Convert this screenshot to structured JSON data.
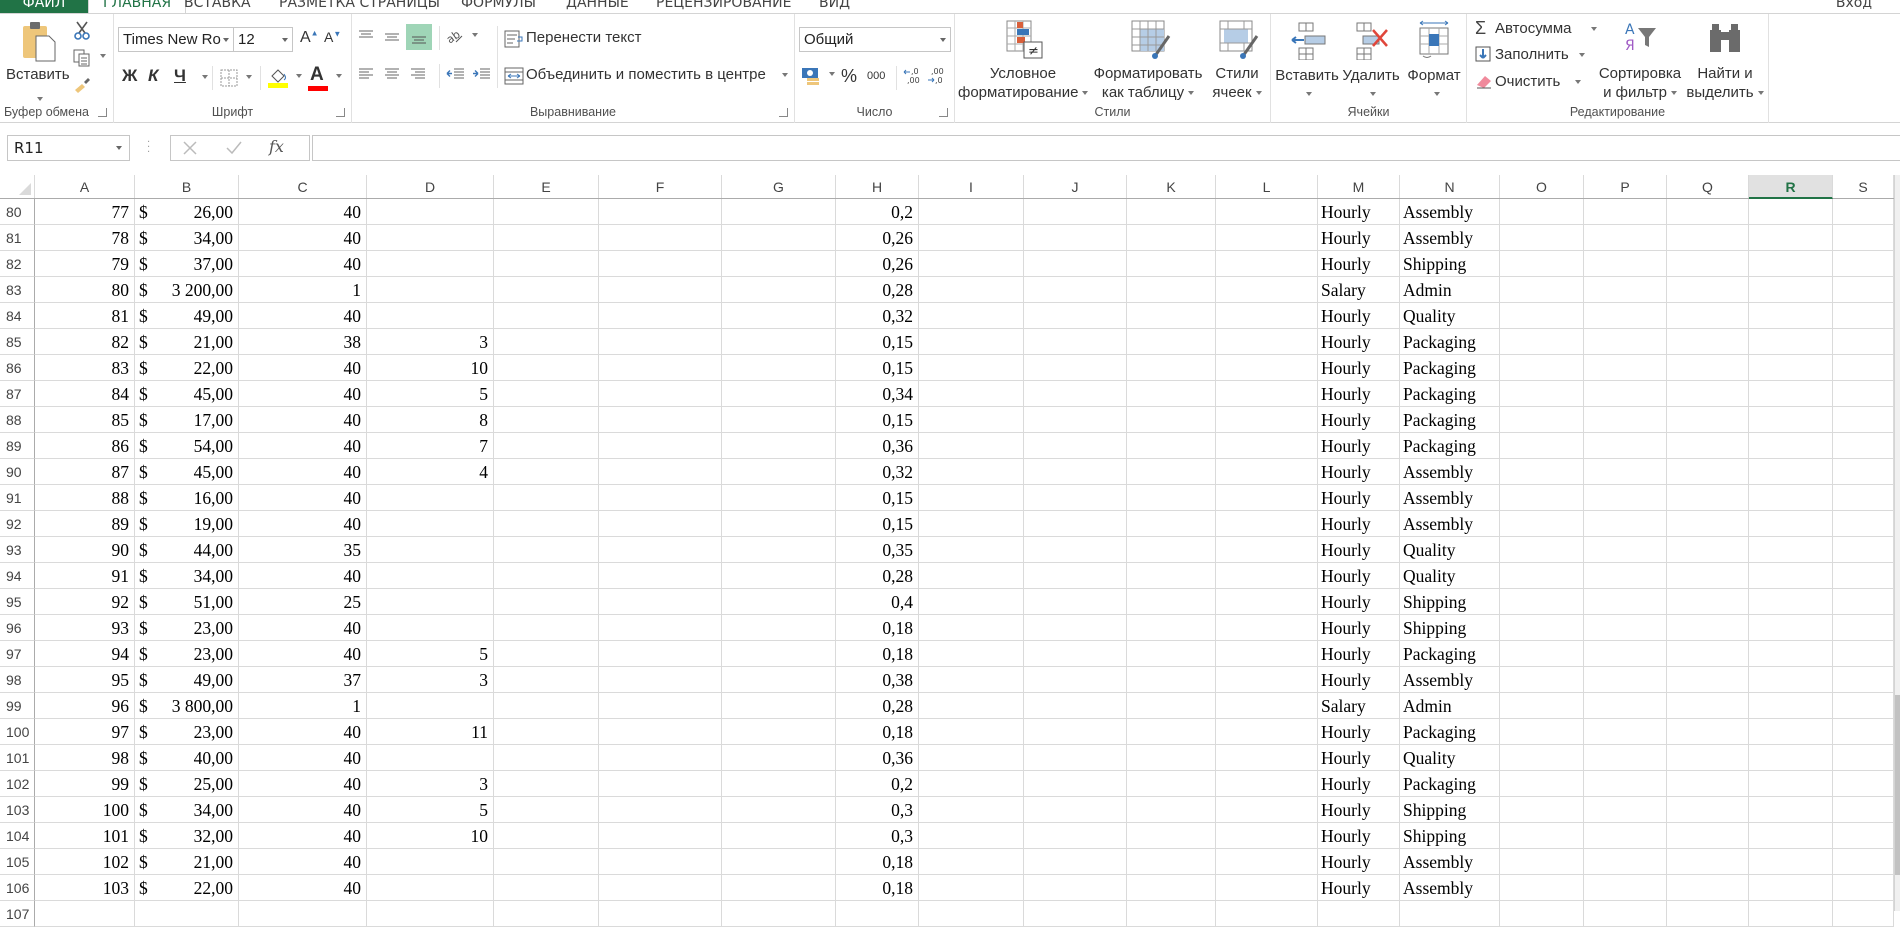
{
  "tabs": [
    {
      "label": "ФАЙЛ",
      "active": false
    },
    {
      "label": "ГЛАВНАЯ",
      "active": true
    },
    {
      "label": "ВСТАВКА",
      "active": false
    },
    {
      "label": "РАЗМЕТКА СТРАНИЦЫ",
      "active": false
    },
    {
      "label": "ФОРМУЛЫ",
      "active": false
    },
    {
      "label": "ДАННЫЕ",
      "active": false
    },
    {
      "label": "РЕЦЕНЗИРОВАНИЕ",
      "active": false
    },
    {
      "label": "ВИД",
      "active": false
    }
  ],
  "signin_label": "Вход",
  "ribbon": {
    "clipboard": {
      "group_label": "Буфер обмена",
      "paste_label": "Вставить"
    },
    "font": {
      "group_label": "Шрифт",
      "font_name": "Times New Ro",
      "font_size": "12",
      "bold": "Ж",
      "italic": "К",
      "underline": "Ч",
      "font_color_glyph": "A",
      "fill_color": "#ffff00",
      "font_color": "#ff0000"
    },
    "alignment": {
      "group_label": "Выравнивание",
      "wrap_text": "Перенести текст",
      "merge_center": "Объединить и поместить в центре"
    },
    "number": {
      "group_label": "Число",
      "format": "Общий",
      "percent": "%",
      "thousands": "000",
      "inc_decimal": "←,0 ,00",
      "dec_decimal": ",00 →,0"
    },
    "styles": {
      "group_label": "Стили",
      "conditional_line1": "Условное",
      "conditional_line2": "форматирование",
      "format_table_line1": "Форматировать",
      "format_table_line2": "как таблицу",
      "cell_styles_line1": "Стили",
      "cell_styles_line2": "ячеек"
    },
    "cells": {
      "group_label": "Ячейки",
      "insert": "Вставить",
      "delete": "Удалить",
      "format": "Формат"
    },
    "editing": {
      "group_label": "Редактирование",
      "autosum": "Автосумма",
      "fill": "Заполнить",
      "clear": "Очистить",
      "sort_line1": "Сортировка",
      "sort_line2": "и фильтр",
      "find_line1": "Найти и",
      "find_line2": "выделить"
    }
  },
  "formula_bar": {
    "name_box": "R11",
    "formula": ""
  },
  "grid": {
    "columns": [
      "A",
      "B",
      "C",
      "D",
      "E",
      "F",
      "G",
      "H",
      "I",
      "J",
      "K",
      "L",
      "M",
      "N",
      "O",
      "P",
      "Q",
      "R",
      "S"
    ],
    "selected_column": "R",
    "rows": [
      {
        "n": "80",
        "A": "77",
        "B_cur": "$",
        "B_amt": "26,00",
        "C": "40",
        "D": "",
        "H": "0,2",
        "M": "Hourly",
        "N": "Assembly"
      },
      {
        "n": "81",
        "A": "78",
        "B_cur": "$",
        "B_amt": "34,00",
        "C": "40",
        "D": "",
        "H": "0,26",
        "M": "Hourly",
        "N": "Assembly"
      },
      {
        "n": "82",
        "A": "79",
        "B_cur": "$",
        "B_amt": "37,00",
        "C": "40",
        "D": "",
        "H": "0,26",
        "M": "Hourly",
        "N": "Shipping"
      },
      {
        "n": "83",
        "A": "80",
        "B_cur": "$",
        "B_amt": "3 200,00",
        "C": "1",
        "D": "",
        "H": "0,28",
        "M": "Salary",
        "N": "Admin"
      },
      {
        "n": "84",
        "A": "81",
        "B_cur": "$",
        "B_amt": "49,00",
        "C": "40",
        "D": "",
        "H": "0,32",
        "M": "Hourly",
        "N": "Quality"
      },
      {
        "n": "85",
        "A": "82",
        "B_cur": "$",
        "B_amt": "21,00",
        "C": "38",
        "D": "3",
        "H": "0,15",
        "M": "Hourly",
        "N": "Packaging"
      },
      {
        "n": "86",
        "A": "83",
        "B_cur": "$",
        "B_amt": "22,00",
        "C": "40",
        "D": "10",
        "H": "0,15",
        "M": "Hourly",
        "N": "Packaging"
      },
      {
        "n": "87",
        "A": "84",
        "B_cur": "$",
        "B_amt": "45,00",
        "C": "40",
        "D": "5",
        "H": "0,34",
        "M": "Hourly",
        "N": "Packaging"
      },
      {
        "n": "88",
        "A": "85",
        "B_cur": "$",
        "B_amt": "17,00",
        "C": "40",
        "D": "8",
        "H": "0,15",
        "M": "Hourly",
        "N": "Packaging"
      },
      {
        "n": "89",
        "A": "86",
        "B_cur": "$",
        "B_amt": "54,00",
        "C": "40",
        "D": "7",
        "H": "0,36",
        "M": "Hourly",
        "N": "Packaging"
      },
      {
        "n": "90",
        "A": "87",
        "B_cur": "$",
        "B_amt": "45,00",
        "C": "40",
        "D": "4",
        "H": "0,32",
        "M": "Hourly",
        "N": "Assembly"
      },
      {
        "n": "91",
        "A": "88",
        "B_cur": "$",
        "B_amt": "16,00",
        "C": "40",
        "D": "",
        "H": "0,15",
        "M": "Hourly",
        "N": "Assembly"
      },
      {
        "n": "92",
        "A": "89",
        "B_cur": "$",
        "B_amt": "19,00",
        "C": "40",
        "D": "",
        "H": "0,15",
        "M": "Hourly",
        "N": "Assembly"
      },
      {
        "n": "93",
        "A": "90",
        "B_cur": "$",
        "B_amt": "44,00",
        "C": "35",
        "D": "",
        "H": "0,35",
        "M": "Hourly",
        "N": "Quality"
      },
      {
        "n": "94",
        "A": "91",
        "B_cur": "$",
        "B_amt": "34,00",
        "C": "40",
        "D": "",
        "H": "0,28",
        "M": "Hourly",
        "N": "Quality"
      },
      {
        "n": "95",
        "A": "92",
        "B_cur": "$",
        "B_amt": "51,00",
        "C": "25",
        "D": "",
        "H": "0,4",
        "M": "Hourly",
        "N": "Shipping"
      },
      {
        "n": "96",
        "A": "93",
        "B_cur": "$",
        "B_amt": "23,00",
        "C": "40",
        "D": "",
        "H": "0,18",
        "M": "Hourly",
        "N": "Shipping"
      },
      {
        "n": "97",
        "A": "94",
        "B_cur": "$",
        "B_amt": "23,00",
        "C": "40",
        "D": "5",
        "H": "0,18",
        "M": "Hourly",
        "N": "Packaging"
      },
      {
        "n": "98",
        "A": "95",
        "B_cur": "$",
        "B_amt": "49,00",
        "C": "37",
        "D": "3",
        "H": "0,38",
        "M": "Hourly",
        "N": "Assembly"
      },
      {
        "n": "99",
        "A": "96",
        "B_cur": "$",
        "B_amt": "3 800,00",
        "C": "1",
        "D": "",
        "H": "0,28",
        "M": "Salary",
        "N": "Admin"
      },
      {
        "n": "100",
        "A": "97",
        "B_cur": "$",
        "B_amt": "23,00",
        "C": "40",
        "D": "11",
        "H": "0,18",
        "M": "Hourly",
        "N": "Packaging"
      },
      {
        "n": "101",
        "A": "98",
        "B_cur": "$",
        "B_amt": "40,00",
        "C": "40",
        "D": "",
        "H": "0,36",
        "M": "Hourly",
        "N": "Quality"
      },
      {
        "n": "102",
        "A": "99",
        "B_cur": "$",
        "B_amt": "25,00",
        "C": "40",
        "D": "3",
        "H": "0,2",
        "M": "Hourly",
        "N": "Packaging"
      },
      {
        "n": "103",
        "A": "100",
        "B_cur": "$",
        "B_amt": "34,00",
        "C": "40",
        "D": "5",
        "H": "0,3",
        "M": "Hourly",
        "N": "Shipping"
      },
      {
        "n": "104",
        "A": "101",
        "B_cur": "$",
        "B_amt": "32,00",
        "C": "40",
        "D": "10",
        "H": "0,3",
        "M": "Hourly",
        "N": "Shipping"
      },
      {
        "n": "105",
        "A": "102",
        "B_cur": "$",
        "B_amt": "21,00",
        "C": "40",
        "D": "",
        "H": "0,18",
        "M": "Hourly",
        "N": "Assembly"
      },
      {
        "n": "106",
        "A": "103",
        "B_cur": "$",
        "B_amt": "22,00",
        "C": "40",
        "D": "",
        "H": "0,18",
        "M": "Hourly",
        "N": "Assembly"
      },
      {
        "n": "107",
        "A": "",
        "B_cur": "",
        "B_amt": "",
        "C": "",
        "D": "",
        "H": "",
        "M": "",
        "N": ""
      }
    ]
  }
}
